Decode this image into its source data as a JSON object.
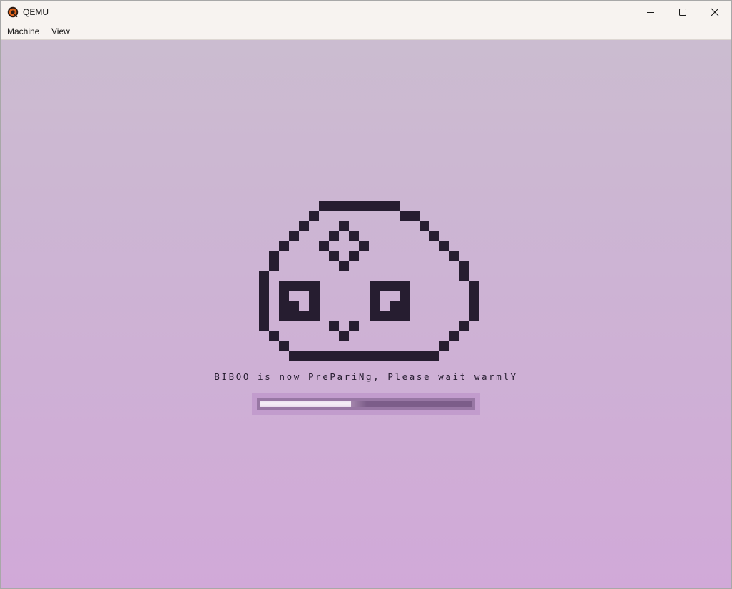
{
  "window": {
    "title": "QEMU",
    "icon": "qemu-logo-icon",
    "controls": {
      "minimize": "minimize-icon",
      "maximize": "maximize-icon",
      "close": "close-icon"
    }
  },
  "menubar": {
    "items": [
      {
        "label": "Machine"
      },
      {
        "label": "View"
      }
    ]
  },
  "screen": {
    "mascot_icon": "pixel-blob-mascot-icon",
    "status_text": "BIBOO is now PrePariNg, Please wait warmlY",
    "progress": 0.43,
    "colors": {
      "background_top": "#cbbcd0",
      "background_bottom": "#d1a9d8",
      "pixel_ink": "#261d30"
    }
  }
}
